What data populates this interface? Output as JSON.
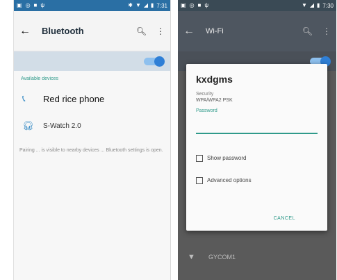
{
  "left": {
    "status": {
      "time": "7:31"
    },
    "appbar": {
      "title": "Bluetooth"
    },
    "section_label": "Available devices",
    "devices": [
      {
        "name": "Red rice phone",
        "icon": "phone-icon"
      },
      {
        "name": "S-Watch 2.0",
        "icon": "headphones-icon"
      }
    ],
    "note": "Pairing ... is visible to nearby devices ... Bluetooth settings is open."
  },
  "right": {
    "status": {
      "time": "7:30"
    },
    "appbar": {
      "title": "Wi-Fi"
    },
    "dialog": {
      "title": "kxdgms",
      "security_label": "Security",
      "security_value": "WPA/WPA2 PSK",
      "password_label": "Password",
      "password_value": "",
      "show_password": "Show password",
      "advanced_options": "Advanced options",
      "cancel": "CANCEL"
    },
    "network_below": "GYCOM1"
  },
  "colors": {
    "accent": "#2f9a8a",
    "bt_blue": "#2f7fd6"
  }
}
